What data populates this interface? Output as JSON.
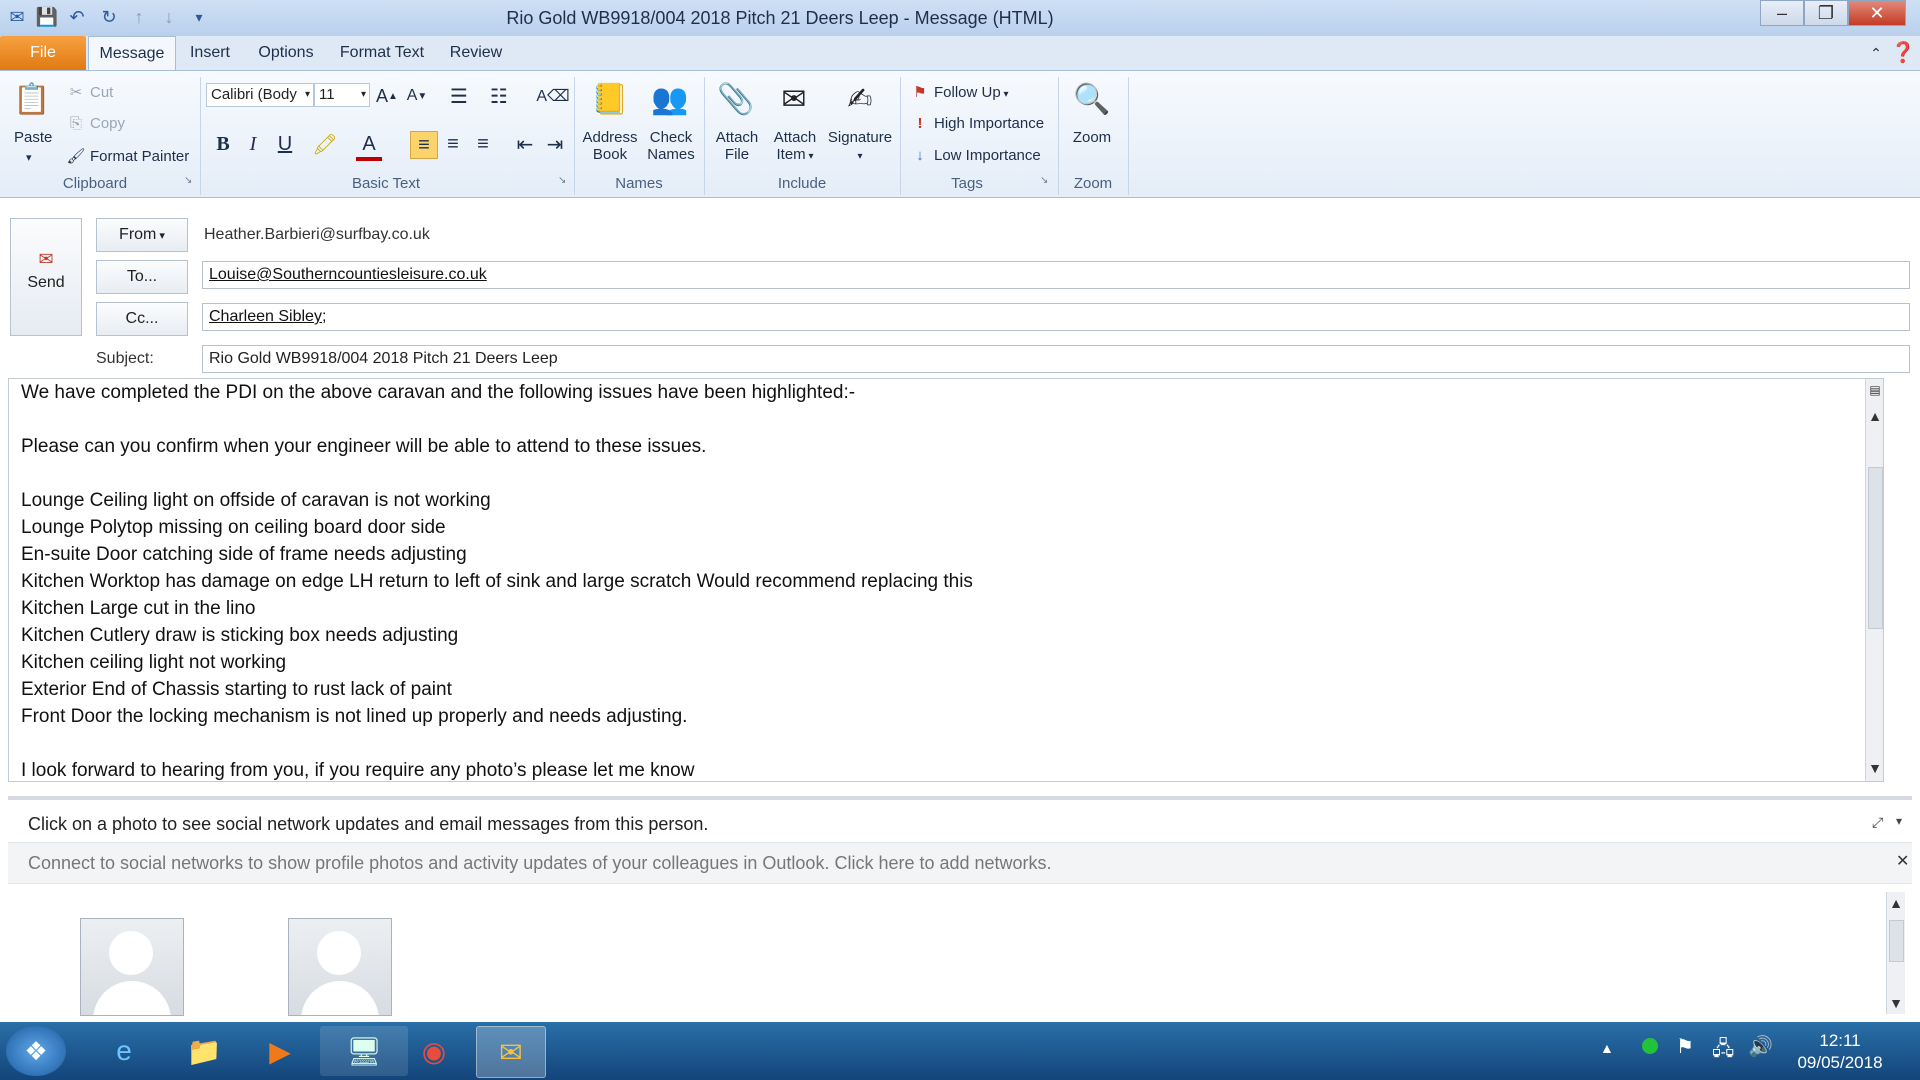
{
  "window": {
    "title": "Rio Gold WB9918/004 2018 Pitch 21 Deers Leep   -  Message (HTML)",
    "qat_icons": [
      "save-icon",
      "undo-icon",
      "redo-icon",
      "up-icon",
      "down-icon",
      "customize-icon"
    ]
  },
  "tabs": [
    "File",
    "Message",
    "Insert",
    "Options",
    "Format Text",
    "Review"
  ],
  "ribbon": {
    "clipboard": {
      "paste": "Paste",
      "cut": "Cut",
      "copy": "Copy",
      "format_painter": "Format Painter",
      "label": "Clipboard"
    },
    "basic_text": {
      "font": "Calibri (Body",
      "size": "11",
      "label": "Basic Text"
    },
    "names": {
      "address": "Address",
      "book": "Book",
      "check": "Check",
      "names": "Names",
      "label": "Names"
    },
    "include": {
      "attach": "Attach",
      "file": "File",
      "item": "Item",
      "signature": "Signature",
      "label": "Include"
    },
    "tags": {
      "follow_up": "Follow Up",
      "high": "High Importance",
      "low": "Low Importance",
      "label": "Tags"
    },
    "zoom": {
      "zoom": "Zoom",
      "label": "Zoom"
    }
  },
  "header": {
    "send": "Send",
    "from_btn": "From",
    "from_value": "Heather.Barbieri@surfbay.co.uk",
    "to_btn": "To...",
    "to_value": "Louise@Southerncountiesleisure.co.uk",
    "cc_btn": "Cc...",
    "cc_value": "Charleen Sibley;",
    "subject_label": "Subject:",
    "subject_value": "Rio Gold WB9918/004 2018 Pitch 21 Deers Leep"
  },
  "body_lines": [
    "We have completed the PDI on the above caravan and the following issues have been highlighted:-",
    "",
    "Please can you confirm when your engineer will be able to attend to these issues.",
    "",
    "Lounge Ceiling light on offside of caravan is not working",
    "Lounge Polytop missing on ceiling board door side",
    "En-suite Door catching side of frame needs adjusting",
    "Kitchen  Worktop has damage on edge LH return to left of sink and large scratch Would recommend replacing this",
    "Kitchen Large cut in the lino",
    "Kitchen Cutlery draw is sticking box needs adjusting",
    "Kitchen ceiling light not working",
    "Exterior End of Chassis  starting to rust lack of paint",
    "Front Door the locking mechanism is not lined up properly and needs adjusting.",
    "",
    "I look forward to hearing from you, if you require any photo’s please let me know"
  ],
  "social": {
    "info": "Click on a photo to see social network updates and email messages from this person.",
    "connect": "Connect to social networks to show profile photos and activity updates of your colleagues in Outlook. Click here to add networks."
  },
  "taskbar": {
    "time": "12:11",
    "date": "09/05/2018"
  }
}
